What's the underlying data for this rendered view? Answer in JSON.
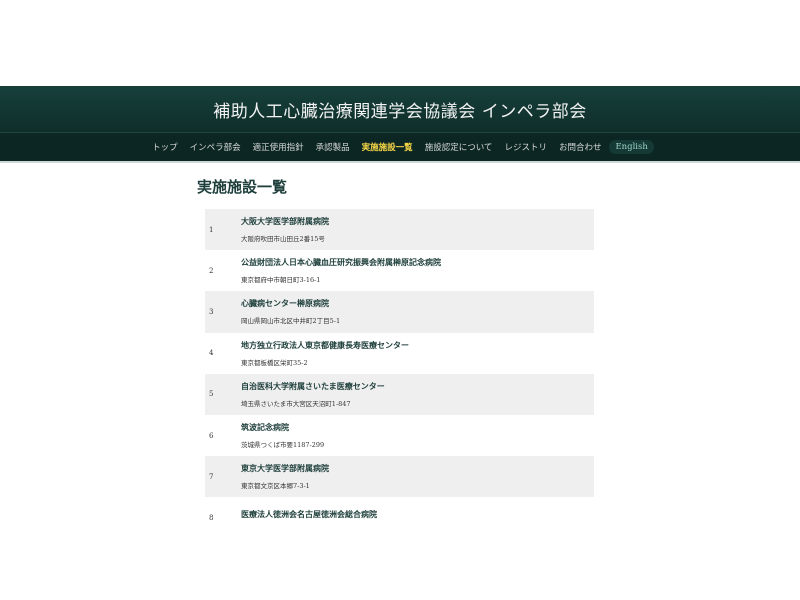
{
  "site": {
    "title": "補助人工心臓治療関連学会協議会 インペラ部会"
  },
  "nav": {
    "items": [
      {
        "label": "トップ"
      },
      {
        "label": "インペラ部会"
      },
      {
        "label": "適正使用指針"
      },
      {
        "label": "承認製品"
      },
      {
        "label": "実施施設一覧"
      },
      {
        "label": "施設認定について"
      },
      {
        "label": "レジストリ"
      },
      {
        "label": "お問合わせ"
      },
      {
        "label": "English"
      }
    ],
    "active_index": 4
  },
  "page": {
    "title": "実施施設一覧"
  },
  "facilities": [
    {
      "num": "1",
      "name": "大阪大学医学部附属病院",
      "address": "大阪府吹田市山田丘2番15号"
    },
    {
      "num": "2",
      "name": "公益財団法人日本心臓血圧研究振興会附属榊原記念病院",
      "address": "東京都府中市朝日町3-16-1"
    },
    {
      "num": "3",
      "name": "心臓病センター榊原病院",
      "address": "岡山県岡山市北区中井町2丁目5-1"
    },
    {
      "num": "4",
      "name": "地方独立行政法人東京都健康長寿医療センター",
      "address": "東京都板橋区栄町35-2"
    },
    {
      "num": "5",
      "name": "自治医科大学附属さいたま医療センター",
      "address": "埼玉県さいたま市大宮区天沼町1-847"
    },
    {
      "num": "6",
      "name": "筑波記念病院",
      "address": "茨城県つくば市要1187-299"
    },
    {
      "num": "7",
      "name": "東京大学医学部附属病院",
      "address": "東京都文京区本郷7-3-1"
    },
    {
      "num": "8",
      "name": "医療法人徳洲会名古屋徳洲会総合病院",
      "address": ""
    }
  ],
  "colors": {
    "header_bg": "#17403b",
    "nav_bg": "#0c2723",
    "active_nav": "#f5d547",
    "title_color": "#1e3f3b",
    "row_alt": "#efefef"
  }
}
